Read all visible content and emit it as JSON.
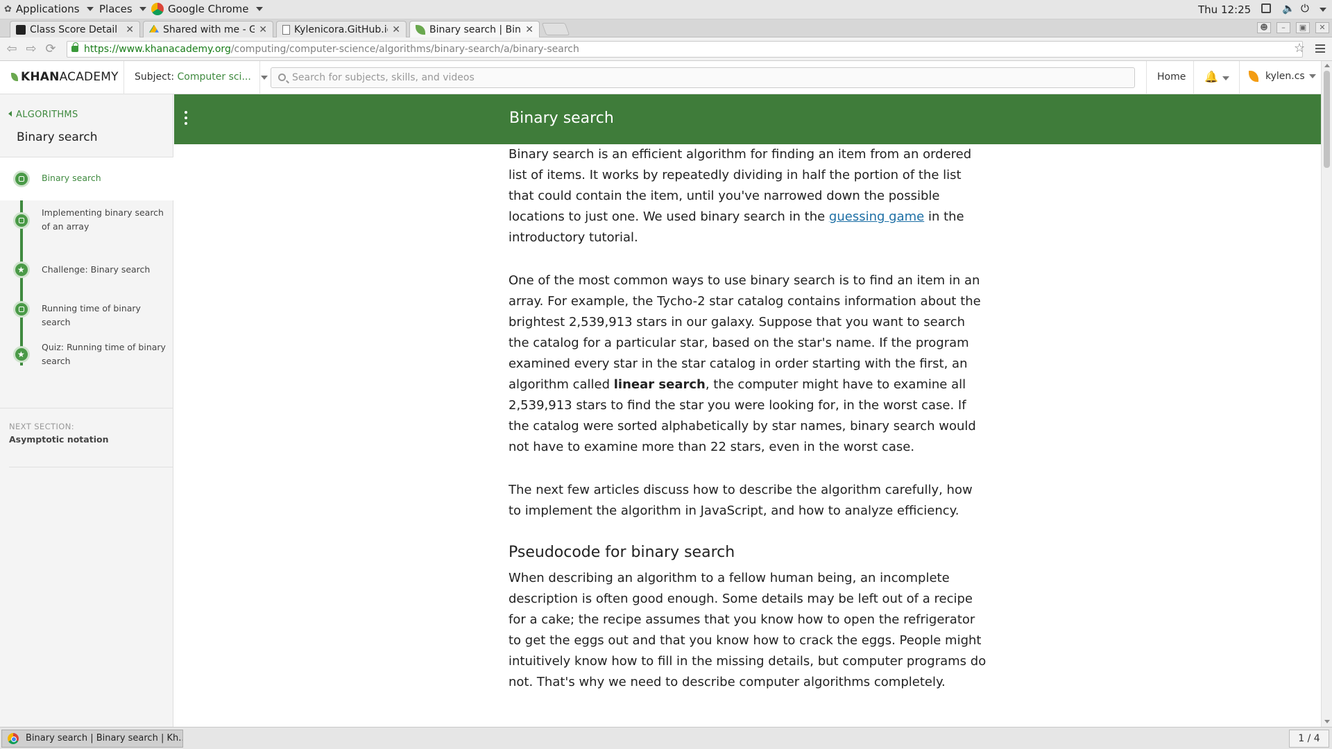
{
  "system_bar": {
    "applications": "Applications",
    "places": "Places",
    "active_app": "Google Chrome",
    "clock": "Thu 12:25"
  },
  "browser": {
    "tabs": [
      {
        "title": "Class Score Detail",
        "icon": "gradebook-icon"
      },
      {
        "title": "Shared with me - Go",
        "icon": "google-drive-icon"
      },
      {
        "title": "Kylenicora.GitHub.io",
        "icon": "page-icon"
      },
      {
        "title": "Binary search | Binar",
        "icon": "khan-leaf-icon"
      }
    ],
    "url_host": "https://www.khanacademy.org",
    "url_path": "/computing/computer-science/algorithms/binary-search/a/binary-search"
  },
  "ka_header": {
    "logo_bold": "KHAN",
    "logo_light": "ACADEMY",
    "subject_label": "Subject:",
    "subject_value": "Computer sci...",
    "search_placeholder": "Search for subjects, skills, and videos",
    "home": "Home",
    "username": "kylen.cs"
  },
  "sidebar": {
    "back_label": "ALGORITHMS",
    "title": "Binary search",
    "items": [
      {
        "label": "Binary search",
        "type": "article",
        "active": true
      },
      {
        "label": "Implementing binary search of an array",
        "type": "article"
      },
      {
        "label": "Challenge: Binary search",
        "type": "challenge"
      },
      {
        "label": "Running time of binary search",
        "type": "article"
      },
      {
        "label": "Quiz: Running time of binary search",
        "type": "quiz"
      }
    ],
    "next_section_label": "NEXT SECTION:",
    "next_section_value": "Asymptotic notation"
  },
  "article": {
    "title": "Binary search",
    "p1_a": "Binary search is an efficient algorithm for finding an item from an ordered list of items. It works by repeatedly dividing in half the portion of the list that could contain the item, until you've narrowed down the possible locations to just one. We used binary search in the ",
    "p1_link": "guessing game",
    "p1_b": " in the introductory tutorial.",
    "p2_a": "One of the most common ways to use binary search is to find an item in an array. For example, the Tycho-2 star catalog contains information about the brightest 2,539,913 stars in our galaxy. Suppose that you want to search the catalog for a particular star, based on the star's name. If the program examined every star in the star catalog in order starting with the first, an algorithm called ",
    "p2_bold": "linear search",
    "p2_b": ", the computer might have to examine all 2,539,913 stars to find the star you were looking for, in the worst case. If the catalog were sorted alphabetically by star names, binary search would not have to examine more than 22 stars, even in the worst case.",
    "p3": "The next few articles discuss how to describe the algorithm carefully, how to implement the algorithm in JavaScript, and how to analyze efficiency.",
    "h2": "Pseudocode for binary search",
    "p4": "When describing an algorithm to a fellow human being, an incomplete description is often good enough. Some details may be left out of a recipe for a cake; the recipe assumes that you know how to open the refrigerator to get the eggs out and that you know how to crack the eggs. People might intuitively know how to fill in the missing details, but computer programs do not. That's why we need to describe computer algorithms completely."
  },
  "taskbar": {
    "window_title": "Binary search | Binary search | Kh...",
    "workspace": "1 / 4"
  },
  "colors": {
    "ka_green": "#3f7c3a",
    "link_blue": "#1d6fa5"
  }
}
